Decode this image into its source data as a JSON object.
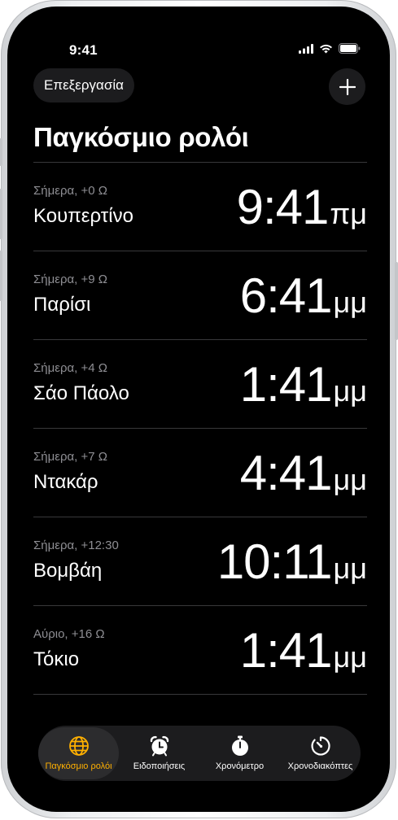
{
  "status_bar": {
    "time": "9:41"
  },
  "header": {
    "edit_label": "Επεξεργασία",
    "title": "Παγκόσμιο ρολόι"
  },
  "clocks": [
    {
      "offset": "Σήμερα, +0 Ω",
      "city": "Κουπερτίνο",
      "time": "9:41",
      "ampm": "πμ"
    },
    {
      "offset": "Σήμερα, +9 Ω",
      "city": "Παρίσι",
      "time": "6:41",
      "ampm": "μμ"
    },
    {
      "offset": "Σήμερα, +4 Ω",
      "city": "Σάο Πάολο",
      "time": "1:41",
      "ampm": "μμ"
    },
    {
      "offset": "Σήμερα, +7 Ω",
      "city": "Ντακάρ",
      "time": "4:41",
      "ampm": "μμ"
    },
    {
      "offset": "Σήμερα, +12:30",
      "city": "Βομβάη",
      "time": "10:11",
      "ampm": "μμ"
    },
    {
      "offset": "Αύριο, +16 Ω",
      "city": "Τόκιο",
      "time": "1:41",
      "ampm": "μμ"
    }
  ],
  "tabs": [
    {
      "label": "Παγκόσμιο ρολόι",
      "icon": "globe-icon",
      "active": true
    },
    {
      "label": "Ειδοποιήσεις",
      "icon": "alarm-clock-icon",
      "active": false
    },
    {
      "label": "Χρονόμετρο",
      "icon": "stopwatch-icon",
      "active": false
    },
    {
      "label": "Χρονοδιακόπτες",
      "icon": "timer-icon",
      "active": false
    }
  ],
  "colors": {
    "accent": "#ffb000",
    "background": "#000000",
    "separator": "#38383a",
    "secondary_text": "#8e8e93"
  }
}
